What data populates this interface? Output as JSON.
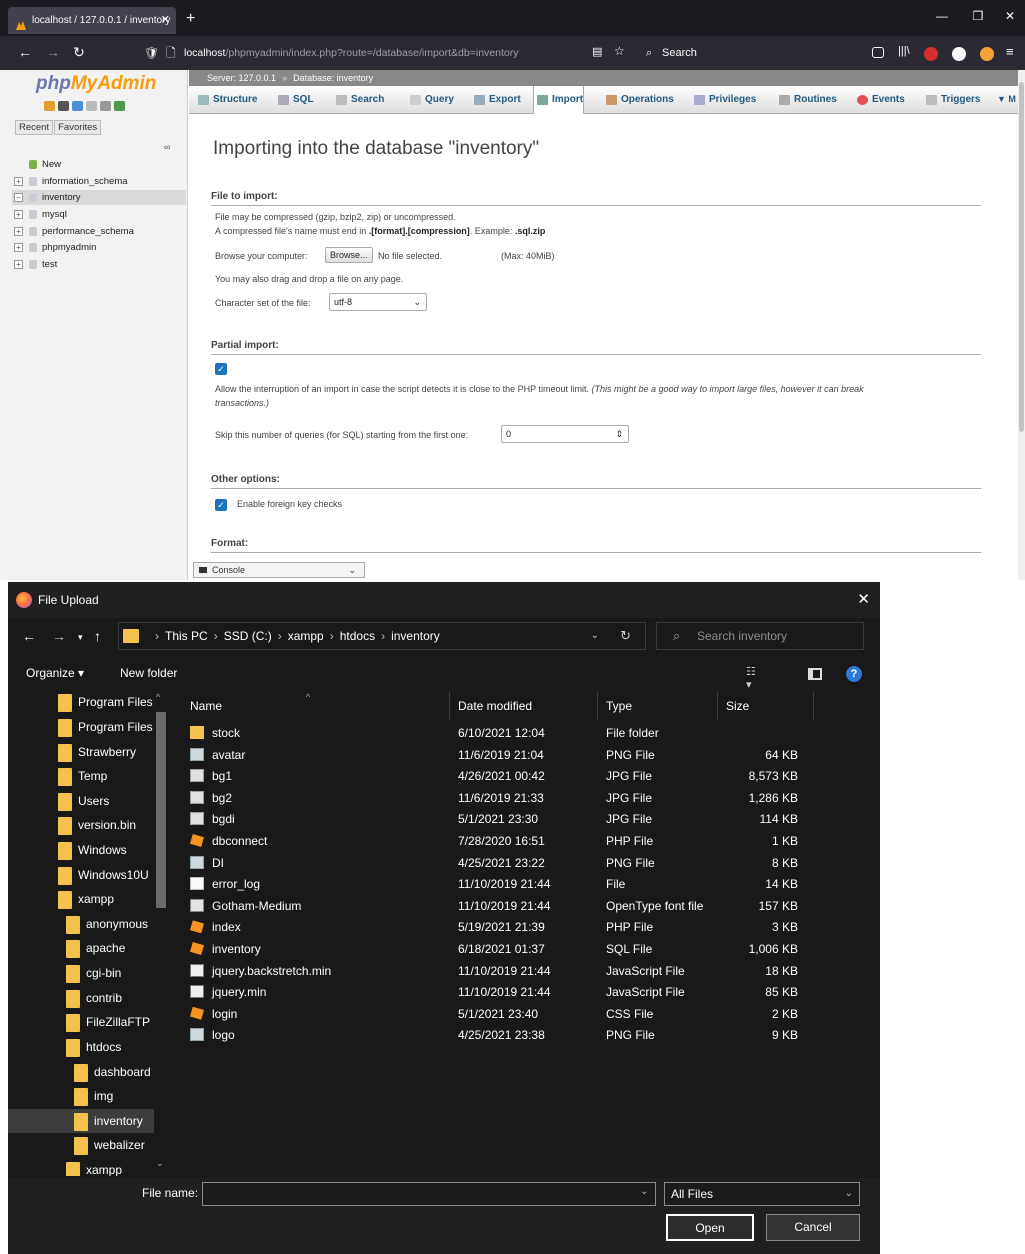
{
  "firefox": {
    "tab_title": "localhost / 127.0.0.1 / inventory",
    "url_host": "localhost",
    "url_path": "/phpmyadmin/index.php?route=/database/import&db=inventory",
    "search_placeholder": "Search"
  },
  "pma": {
    "logo_php": "php",
    "logo_my": "MyAdmin",
    "recent_label": "Recent",
    "favorites_label": "Favorites",
    "tree": [
      "New",
      "information_schema",
      "inventory",
      "mysql",
      "performance_schema",
      "phpmyadmin",
      "test"
    ],
    "breadcrumb_server": "Server: 127.0.0.1",
    "breadcrumb_db": "Database: inventory",
    "tabs": [
      "Structure",
      "SQL",
      "Search",
      "Query",
      "Export",
      "Import",
      "Operations",
      "Privileges",
      "Routines",
      "Events",
      "Triggers"
    ],
    "page_title": "Importing into the database \"inventory\"",
    "file_section": "File to import:",
    "file_note1": "File may be compressed (gzip, bzip2, zip) or uncompressed.",
    "file_note2_a": "A compressed file's name must end in ",
    "file_note2_b": ".[format].[compression]",
    "file_note2_c": ". Example: ",
    "file_note2_d": ".sql.zip",
    "browse_label": "Browse your computer:",
    "browse_button": "Browse...",
    "no_file": "No file selected.",
    "max_size": "(Max: 40MiB)",
    "drag_note": "You may also drag and drop a file on any page.",
    "charset_label": "Character set of the file:",
    "charset_value": "utf-8",
    "partial_section": "Partial import:",
    "partial_note": "Allow the interruption of an import in case the script detects it is close to the PHP timeout limit.",
    "partial_note_italic_1": "(This might be a good way to import large files, however it can break",
    "partial_note_italic_2": "transactions.)",
    "skip_label": "Skip this number of queries (for SQL) starting from the first one:",
    "skip_value": "0",
    "other_section": "Other options:",
    "fk_label": "Enable foreign key checks",
    "format_section": "Format:",
    "console_label": "Console"
  },
  "dialog": {
    "title": "File Upload",
    "path": [
      "This PC",
      "SSD (C:)",
      "xampp",
      "htdocs",
      "inventory"
    ],
    "search_placeholder": "Search inventory",
    "organize": "Organize ▾",
    "new_folder": "New folder",
    "tree": [
      "Program Files",
      "Program Files",
      "Strawberry",
      "Temp",
      "Users",
      "version.bin",
      "Windows",
      "Windows10U",
      "xampp",
      "anonymous",
      "apache",
      "cgi-bin",
      "contrib",
      "FileZillaFTP",
      "htdocs",
      "dashboard",
      "img",
      "inventory",
      "webalizer",
      "xampp"
    ],
    "columns": {
      "name": "Name",
      "date": "Date modified",
      "type": "Type",
      "size": "Size"
    },
    "files": [
      {
        "name": "stock",
        "date": "6/10/2021 12:04",
        "type": "File folder",
        "size": "",
        "icon": "folder-icon"
      },
      {
        "name": "avatar",
        "date": "11/6/2019 21:04",
        "type": "PNG File",
        "size": "64 KB",
        "icon": "png-icon"
      },
      {
        "name": "bg1",
        "date": "4/26/2021 00:42",
        "type": "JPG File",
        "size": "8,573 KB",
        "icon": "jpg-icon"
      },
      {
        "name": "bg2",
        "date": "11/6/2019 21:33",
        "type": "JPG File",
        "size": "1,286 KB",
        "icon": "jpg-icon"
      },
      {
        "name": "bgdi",
        "date": "5/1/2021 23:30",
        "type": "JPG File",
        "size": "114 KB",
        "icon": "jpg-icon"
      },
      {
        "name": "dbconnect",
        "date": "7/28/2020 16:51",
        "type": "PHP File",
        "size": "1 KB",
        "icon": "sublime-icon"
      },
      {
        "name": "DI",
        "date": "4/25/2021 23:22",
        "type": "PNG File",
        "size": "8 KB",
        "icon": "png-icon"
      },
      {
        "name": "error_log",
        "date": "11/10/2019 21:44",
        "type": "File",
        "size": "14 KB",
        "icon": "file-icon"
      },
      {
        "name": "Gotham-Medium",
        "date": "11/10/2019 21:44",
        "type": "OpenType font file",
        "size": "157 KB",
        "icon": "font-icon"
      },
      {
        "name": "index",
        "date": "5/19/2021 21:39",
        "type": "PHP File",
        "size": "3 KB",
        "icon": "sublime-icon"
      },
      {
        "name": "inventory",
        "date": "6/18/2021 01:37",
        "type": "SQL File",
        "size": "1,006 KB",
        "icon": "sublime-icon"
      },
      {
        "name": "jquery.backstretch.min",
        "date": "11/10/2019 21:44",
        "type": "JavaScript File",
        "size": "18 KB",
        "icon": "script-icon"
      },
      {
        "name": "jquery.min",
        "date": "11/10/2019 21:44",
        "type": "JavaScript File",
        "size": "85 KB",
        "icon": "script-icon"
      },
      {
        "name": "login",
        "date": "5/1/2021 23:40",
        "type": "CSS File",
        "size": "2 KB",
        "icon": "sublime-icon"
      },
      {
        "name": "logo",
        "date": "4/25/2021 23:38",
        "type": "PNG File",
        "size": "9 KB",
        "icon": "png-icon"
      }
    ],
    "file_name_label": "File name:",
    "file_name_value": "",
    "file_type": "All Files",
    "open_button": "Open",
    "cancel_button": "Cancel"
  }
}
